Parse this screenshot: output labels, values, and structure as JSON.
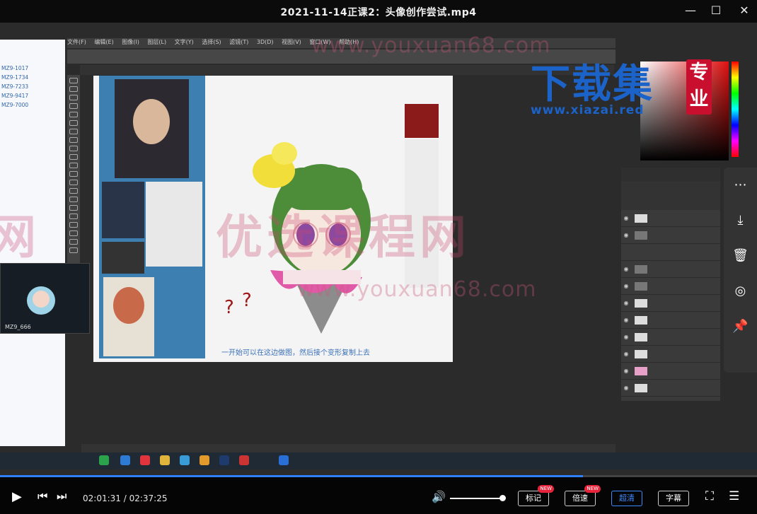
{
  "window": {
    "title": "2021-11-14正课2：头像创作尝试.mp4",
    "min_icon": "minimize-icon",
    "max_icon": "maximize-icon",
    "close_icon": "close-icon"
  },
  "video": {
    "ps_menu": [
      "文件(F)",
      "编辑(E)",
      "图像(I)",
      "图层(L)",
      "文字(Y)",
      "选择(S)",
      "滤镜(T)",
      "3D(D)",
      "视图(V)",
      "窗口(W)",
      "帮助(H)"
    ],
    "caption": "一开始可以在这边做图，然后接个变形复制上去",
    "chat_user": "MZ9_666",
    "watermark": {
      "site_name": "优选课程网",
      "site_url": "www.youxuan68.com"
    },
    "logo": {
      "text": "下载集",
      "seal": "专业",
      "url": "www.xiazai.red"
    }
  },
  "player": {
    "current_time": "02:01:31",
    "separator": " / ",
    "total_time": "02:37:25",
    "progress_fraction": 0.77,
    "volume_fraction": 0.95,
    "buttons": {
      "notes": "标记",
      "speed": "倍速",
      "quality": "超清",
      "subtitle": "字幕"
    },
    "new_badge": "NEW"
  },
  "colors": {
    "accent": "#2f80ff",
    "badge": "#e8233a",
    "quality": "#3d8bff"
  }
}
